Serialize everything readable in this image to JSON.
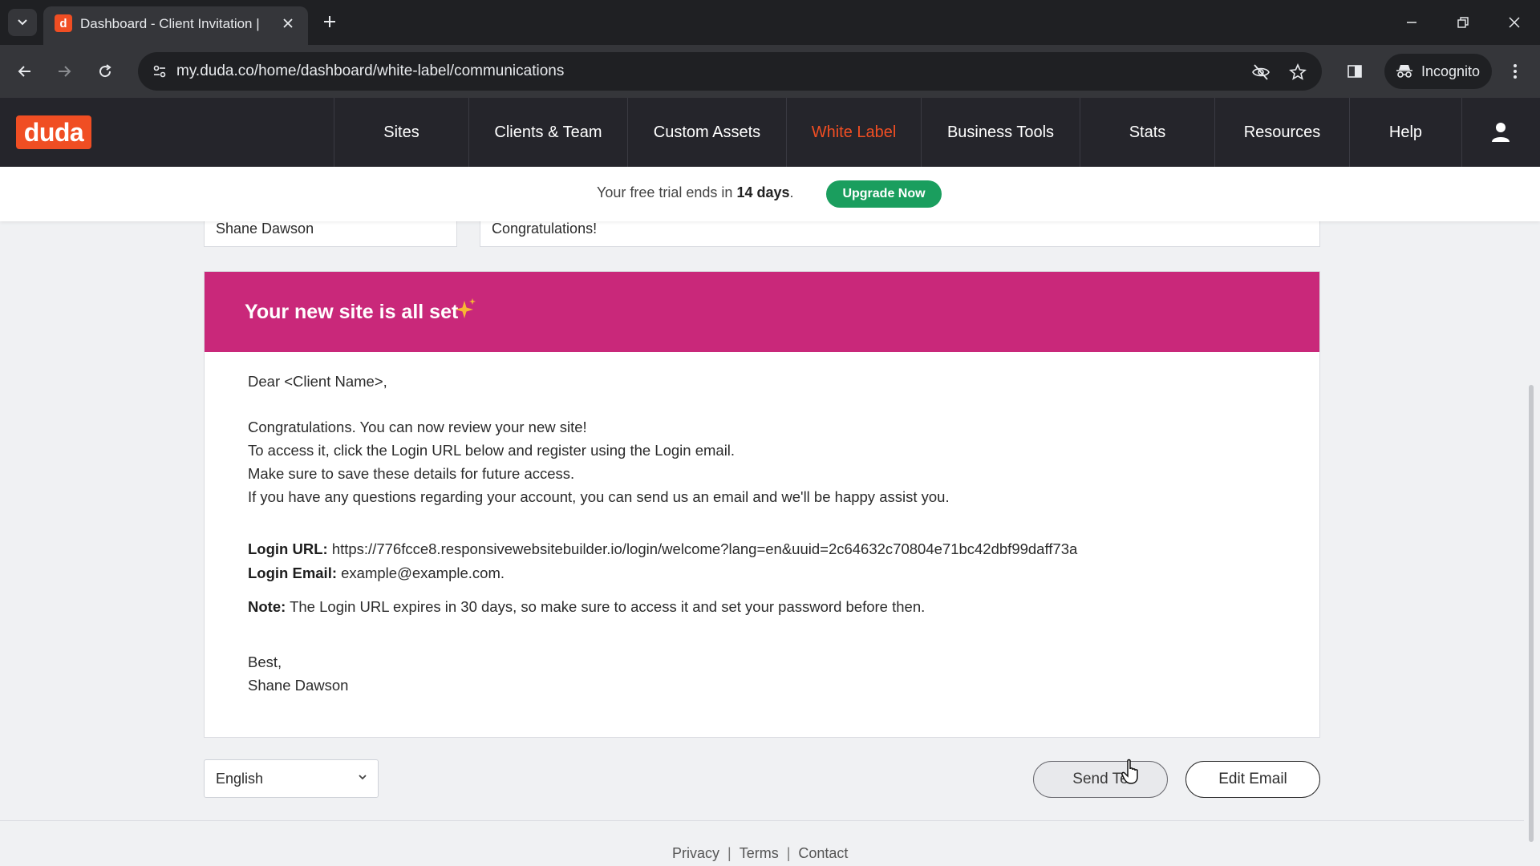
{
  "browser": {
    "tab_title": "Dashboard - Client Invitation | ",
    "url": "my.duda.co/home/dashboard/white-label/communications",
    "incognito_label": "Incognito",
    "favicon_letter": "d"
  },
  "app": {
    "logo": "duda",
    "nav": [
      {
        "label": "Sites"
      },
      {
        "label": "Clients & Team"
      },
      {
        "label": "Custom Assets"
      },
      {
        "label": "White Label",
        "active": true
      },
      {
        "label": "Business Tools"
      },
      {
        "label": "Stats"
      },
      {
        "label": "Resources"
      },
      {
        "label": "Help"
      }
    ],
    "accent_color": "#f04e23"
  },
  "trial": {
    "prefix": "Your free trial ends in ",
    "days": "14 days",
    "suffix": ".",
    "button": "Upgrade Now"
  },
  "form": {
    "sender_name": "Shane Dawson",
    "subject": "Congratulations!"
  },
  "email": {
    "header_color": "#c9287a",
    "headline": "Your new site is all set",
    "greeting": "Dear <Client Name>,",
    "paragraph": [
      "Congratulations. You can now review your new site!",
      "To access it, click the Login URL below and register using the Login email.",
      "Make sure to save these details for future access.",
      "If you have any questions regarding your account, you can send us an email and we'll be happy assist you."
    ],
    "login_url_label": "Login URL:",
    "login_url": "https://776fcce8.responsivewebsitebuilder.io/login/welcome?lang=en&uuid=2c64632c70804e71bc42dbf99daff73a",
    "login_email_label": "Login Email:",
    "login_email": "example@example.com.",
    "note_label": "Note:",
    "note": "The Login URL expires in 30 days, so make sure to access it and set your password before then.",
    "signoff": "Best,",
    "signature": "Shane Dawson"
  },
  "actions": {
    "language": "English",
    "send_test": "Send Te",
    "edit_email": "Edit Email"
  },
  "footer": {
    "links": [
      "Privacy",
      "Terms",
      "Contact"
    ],
    "separator": "|"
  }
}
